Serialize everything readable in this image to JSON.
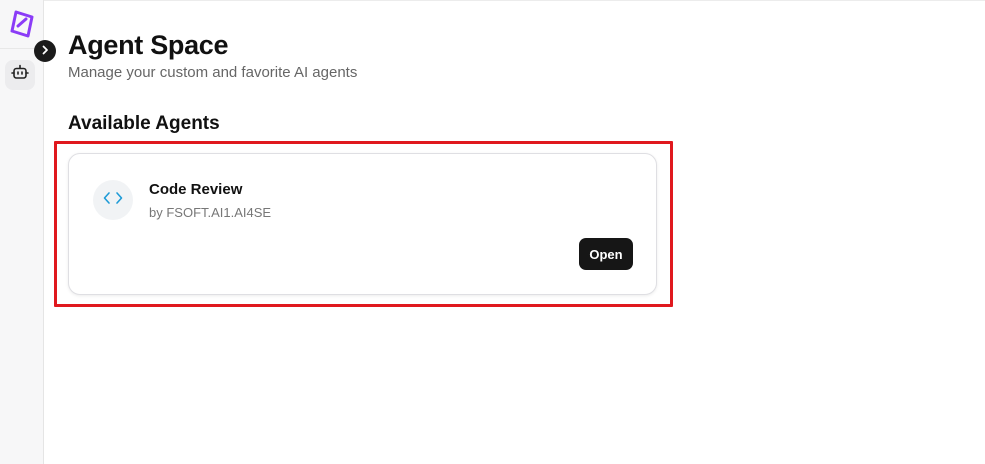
{
  "sidebar": {
    "logo_icon": "brand-logo-icon",
    "toggle_icon": "chevron-right-icon",
    "items": [
      {
        "icon": "robot-icon",
        "label": ""
      }
    ]
  },
  "header": {
    "title": "Agent Space",
    "subtitle": "Manage your custom and favorite AI agents"
  },
  "section": {
    "title": "Available Agents"
  },
  "agents": [
    {
      "name": "Code Review",
      "author": "by FSOFT.AI1.AI4SE",
      "icon": "code-icon",
      "action_label": "Open"
    }
  ],
  "colors": {
    "brand": "#8b3cf7",
    "highlight": "#e0181e",
    "button": "#161616",
    "code_icon": "#1e9bd7"
  }
}
